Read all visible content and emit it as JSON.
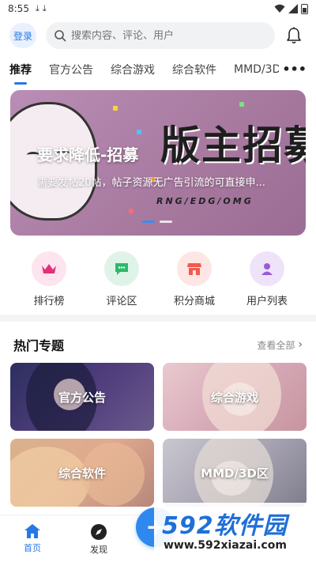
{
  "status_bar": {
    "time": "8:55"
  },
  "header": {
    "login_label": "登录",
    "search_placeholder": "搜索内容、评论、用户"
  },
  "tabs": [
    {
      "label": "推荐",
      "active": true
    },
    {
      "label": "官方公告"
    },
    {
      "label": "综合游戏"
    },
    {
      "label": "综合软件"
    },
    {
      "label": "MMD/3D"
    }
  ],
  "tabs_more": "•••",
  "banner": {
    "title": "要求降低-招募",
    "description": "需要发帖20帖，帖子资源无广告引流的可直接申...",
    "art_title": "版主招募",
    "art_subtitle": "RNG/EDG/OMG",
    "active_slide": 0,
    "slides": 2
  },
  "quick_links": [
    {
      "label": "排行榜",
      "icon": "crown-icon",
      "bg": "#fde4ef",
      "color": "#e2307a"
    },
    {
      "label": "评论区",
      "icon": "chat-icon",
      "bg": "#dff4e8",
      "color": "#2eb86b"
    },
    {
      "label": "积分商城",
      "icon": "shop-icon",
      "bg": "#fde6e4",
      "color": "#ef5b4c"
    },
    {
      "label": "用户列表",
      "icon": "user-icon",
      "bg": "#efe3fa",
      "color": "#9b5bd6"
    }
  ],
  "hot_topics": {
    "title": "热门专题",
    "more_label": "查看全部",
    "cards": [
      {
        "label": "官方公告"
      },
      {
        "label": "综合游戏"
      },
      {
        "label": "综合软件"
      },
      {
        "label": "MMD/3D区"
      }
    ]
  },
  "bottom_nav": [
    {
      "label": "首页",
      "active": true
    },
    {
      "label": "发现"
    }
  ],
  "fab_label": "+",
  "watermark": {
    "logo": "592软件园",
    "url": "www.592xiazai.com"
  },
  "colors": {
    "accent": "#2678e6"
  }
}
